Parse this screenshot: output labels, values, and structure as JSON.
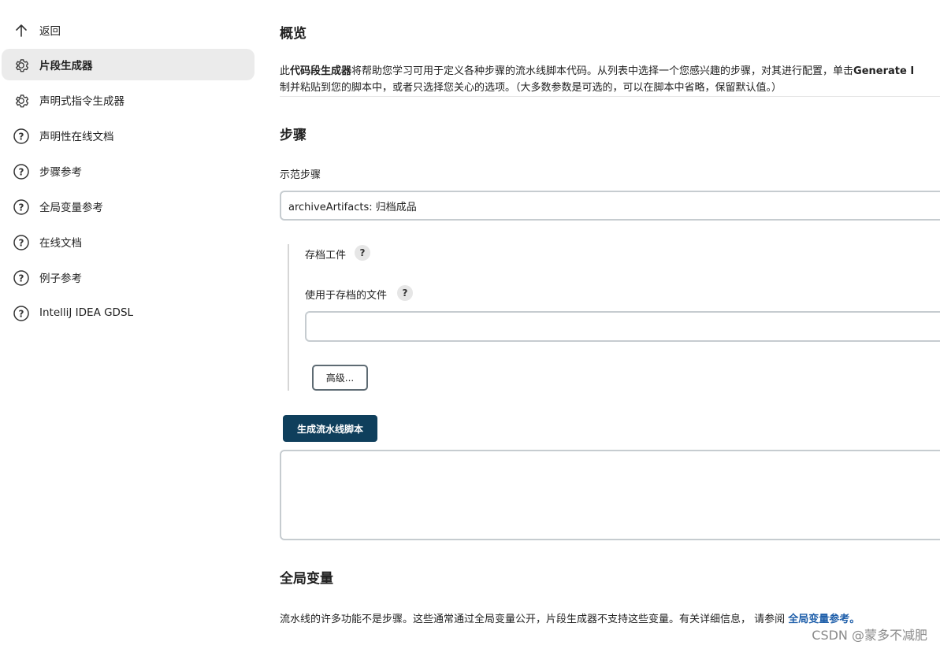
{
  "sidebar": {
    "items": [
      {
        "label": "返回",
        "icon": "arrow-up-icon"
      },
      {
        "label": "片段生成器",
        "icon": "gear-icon",
        "active": true
      },
      {
        "label": "声明式指令生成器",
        "icon": "gear-icon"
      },
      {
        "label": "声明性在线文档",
        "icon": "help-circle-icon"
      },
      {
        "label": "步骤参考",
        "icon": "help-circle-icon"
      },
      {
        "label": "全局变量参考",
        "icon": "help-circle-icon"
      },
      {
        "label": "在线文档",
        "icon": "help-circle-icon"
      },
      {
        "label": "例子参考",
        "icon": "help-circle-icon"
      },
      {
        "label": "IntelliJ IDEA GDSL",
        "icon": "help-circle-icon"
      }
    ]
  },
  "overview": {
    "title": "概览",
    "desc_pre": "此",
    "desc_bold": "代码段生成器",
    "desc_mid": "将帮助您学习可用于定义各种步骤的流水线脚本代码。从列表中选择一个您感兴趣的步骤，对其进行配置，单击",
    "desc_bold2": "Generate I",
    "desc_line2": "制并粘贴到您的脚本中，或者只选择您关心的选项。（大多数参数是可选的，可以在脚本中省略，保留默认值。）"
  },
  "steps": {
    "title": "步骤",
    "sample_label": "示范步骤",
    "selected_step": "archiveArtifacts: 归档成品",
    "archive_label": "存档工件",
    "files_label": "使用于存档的文件",
    "files_value": "",
    "advanced_button": "高级...",
    "help_glyph": "?"
  },
  "generate_button": "生成流水线脚本",
  "generated_script": "",
  "globals": {
    "title": "全局变量",
    "text": "流水线的许多功能不是步骤。这些通常通过全局变量公开，片段生成器不支持这些变量。有关详细信息， 请参阅 ",
    "link": "全局变量参考。"
  },
  "watermark": "CSDN @蒙多不减肥"
}
